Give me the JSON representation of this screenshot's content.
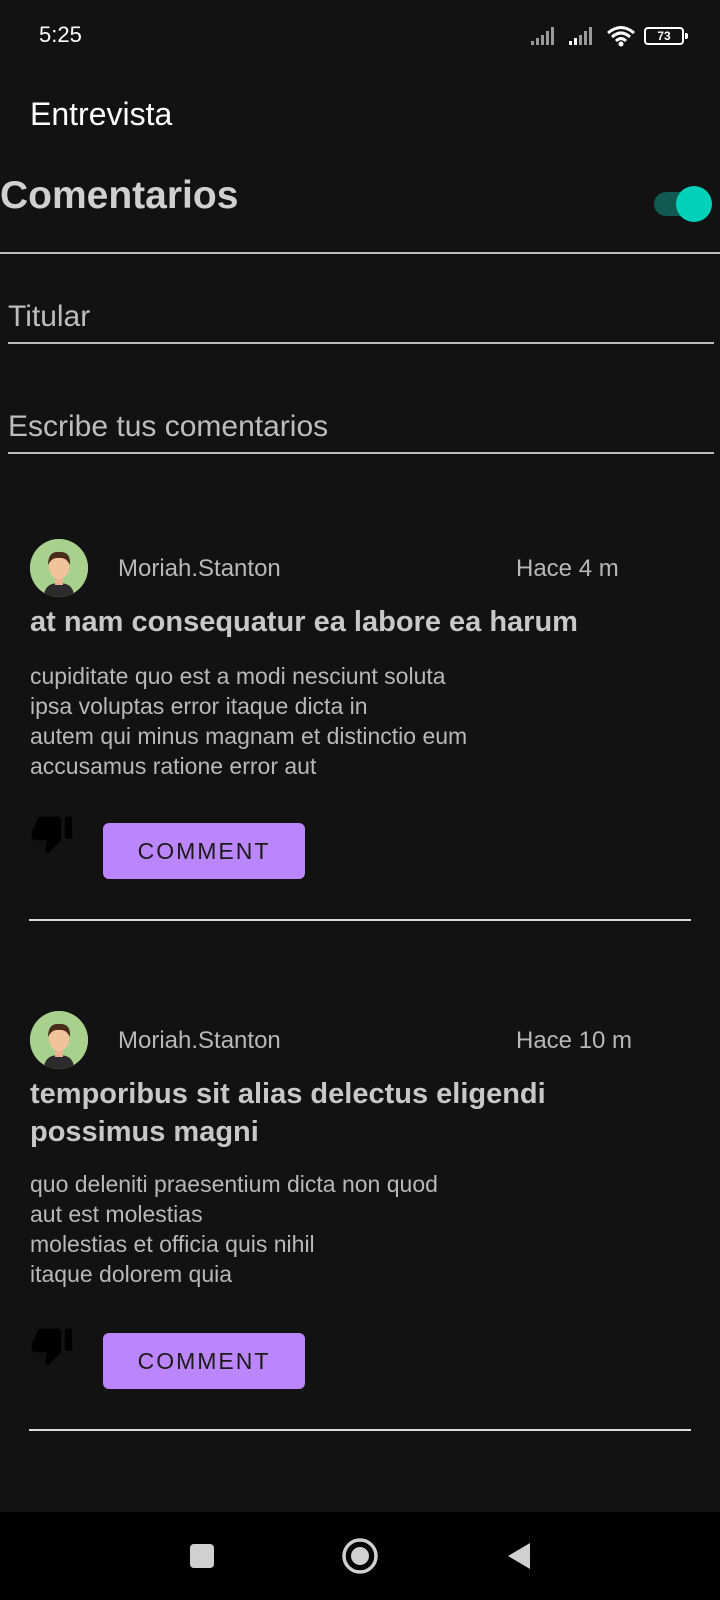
{
  "status_bar": {
    "time": "5:25",
    "battery": "73"
  },
  "header": {
    "app_title": "Entrevista",
    "section_title": "Comentarios",
    "toggle_on": true
  },
  "form": {
    "title_placeholder": "Titular",
    "comment_placeholder": "Escribe tus comentarios"
  },
  "comments": [
    {
      "username": "Moriah.Stanton",
      "time_ago": "Hace 4 m",
      "title": "at nam consequatur ea labore ea harum",
      "body_lines": [
        "cupiditate quo est a modi nesciunt soluta",
        "ipsa voluptas error itaque dicta in",
        "autem qui minus magnam et distinctio eum",
        "accusamus ratione error aut"
      ],
      "button_label": "COMMENT"
    },
    {
      "username": "Moriah.Stanton",
      "time_ago": "Hace 10 m",
      "title": "temporibus sit alias delectus eligendi possimus magni",
      "body_lines": [
        "quo deleniti praesentium dicta non quod",
        "aut est molestias",
        "molestias et officia quis nihil",
        "itaque dolorem quia"
      ],
      "button_label": "COMMENT"
    }
  ],
  "colors": {
    "background": "#121212",
    "accent_button": "#bb86fc",
    "toggle_thumb": "#00d1b8",
    "toggle_track": "#115a52"
  },
  "icons": {
    "status": [
      "signal-icon",
      "signal-icon",
      "wifi-icon",
      "battery-icon"
    ],
    "comment_actions": [
      "thumbs-down-icon"
    ],
    "nav": [
      "recents-square-icon",
      "home-circle-icon",
      "back-triangle-icon"
    ]
  }
}
